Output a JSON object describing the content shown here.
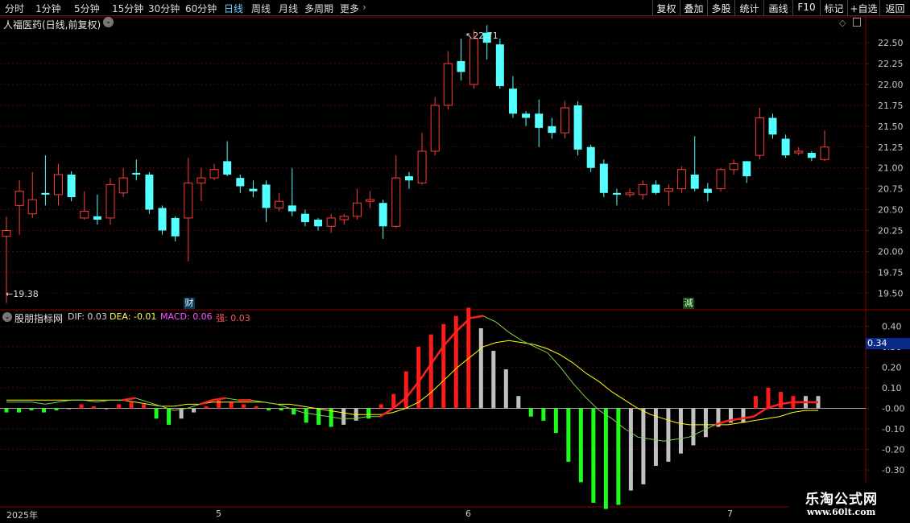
{
  "toolbar": {
    "periods": [
      "分时",
      "1分钟",
      "5分钟",
      "15分钟",
      "30分钟",
      "60分钟",
      "日线",
      "周线",
      "月线",
      "多周期",
      "更多"
    ],
    "active_period": "日线",
    "right_buttons": [
      "复权",
      "叠加",
      "多股",
      "统计",
      "画线",
      "F10",
      "标记",
      "+自选",
      "返回"
    ]
  },
  "main_panel": {
    "title": "人福医药(日线,前复权)",
    "high_label": "22.71",
    "low_label": "19.38",
    "markers": [
      "财",
      "減"
    ],
    "y_ticks": [
      "22.50",
      "22.25",
      "22.00",
      "21.75",
      "21.50",
      "21.25",
      "21.00",
      "20.75",
      "20.50",
      "20.25",
      "20.00",
      "19.75",
      "19.50"
    ]
  },
  "indicator_panel": {
    "name": "股朋指标网",
    "dif_label": "DIF:",
    "dif_value": "0.03",
    "dea_label": "DEA:",
    "dea_value": "-0.01",
    "macd_label": "MACD:",
    "macd_value": "0.06",
    "qiang_label": "强:",
    "qiang_value": "0.03",
    "current_value": "0.34",
    "y_ticks": [
      "0.40",
      "0.30",
      "0.20",
      "0.10",
      "-0.00",
      "-0.10",
      "-0.20",
      "-0.30"
    ]
  },
  "date_axis": {
    "labels": [
      "2025年",
      "5",
      "6",
      "7"
    ]
  },
  "watermark": {
    "line1": "乐淘公式网",
    "line2": "www.60lt.com"
  },
  "colors": {
    "up": "#ff3b3b",
    "down": "#54ffff",
    "grid": "#8b0000",
    "axis_text": "#c8c8c8",
    "dif": "#ffffff",
    "dea": "#ffff00",
    "macd_pos": "#ff1a1a",
    "macd_neg": "#1aff1a",
    "macd_gray": "#c0c0c0"
  },
  "chart_data": {
    "type": "candlestick",
    "price_range": [
      19.3,
      22.8
    ],
    "candles": [
      [
        20.18,
        20.25,
        20.42,
        19.38
      ],
      [
        20.55,
        20.72,
        20.85,
        20.2
      ],
      [
        20.45,
        20.62,
        20.95,
        20.4
      ],
      [
        20.7,
        20.68,
        21.15,
        20.55
      ],
      [
        20.68,
        20.92,
        21.05,
        20.55
      ],
      [
        20.92,
        20.65,
        20.96,
        20.6
      ],
      [
        20.4,
        20.48,
        20.72,
        20.38
      ],
      [
        20.42,
        20.38,
        20.68,
        20.32
      ],
      [
        20.4,
        20.8,
        20.88,
        20.32
      ],
      [
        20.7,
        20.88,
        21.0,
        20.65
      ],
      [
        20.94,
        20.92,
        21.1,
        20.85
      ],
      [
        20.92,
        20.5,
        20.95,
        20.45
      ],
      [
        20.52,
        20.25,
        20.55,
        20.2
      ],
      [
        20.4,
        20.18,
        20.42,
        20.12
      ],
      [
        20.4,
        20.82,
        21.12,
        19.88
      ],
      [
        20.82,
        20.88,
        21.0,
        20.6
      ],
      [
        20.88,
        20.98,
        21.05,
        20.85
      ],
      [
        21.08,
        20.92,
        21.32,
        20.9
      ],
      [
        20.88,
        20.78,
        20.92,
        20.7
      ],
      [
        20.75,
        20.72,
        20.85,
        20.65
      ],
      [
        20.8,
        20.52,
        20.85,
        20.35
      ],
      [
        20.52,
        20.6,
        20.7,
        20.48
      ],
      [
        20.55,
        20.48,
        21.0,
        20.42
      ],
      [
        20.45,
        20.35,
        20.5,
        20.3
      ],
      [
        20.38,
        20.3,
        20.4,
        20.25
      ],
      [
        20.3,
        20.4,
        20.45,
        20.22
      ],
      [
        20.38,
        20.42,
        20.45,
        20.32
      ],
      [
        20.42,
        20.58,
        20.75,
        20.38
      ],
      [
        20.6,
        20.62,
        20.72,
        20.52
      ],
      [
        20.58,
        20.3,
        20.62,
        20.15
      ],
      [
        20.3,
        20.88,
        21.15,
        20.28
      ],
      [
        20.9,
        20.85,
        20.95,
        20.75
      ],
      [
        20.82,
        21.2,
        21.42,
        20.8
      ],
      [
        21.2,
        21.75,
        21.85,
        21.15
      ],
      [
        21.75,
        22.25,
        22.4,
        21.7
      ],
      [
        22.28,
        22.15,
        22.55,
        22.05
      ],
      [
        22.0,
        22.55,
        22.65,
        21.95
      ],
      [
        22.62,
        22.5,
        22.71,
        22.3
      ],
      [
        22.48,
        21.98,
        22.55,
        21.95
      ],
      [
        21.95,
        21.65,
        22.1,
        21.6
      ],
      [
        21.65,
        21.6,
        21.68,
        21.5
      ],
      [
        21.65,
        21.48,
        21.82,
        21.25
      ],
      [
        21.5,
        21.42,
        21.6,
        21.35
      ],
      [
        21.42,
        21.72,
        21.8,
        21.35
      ],
      [
        21.75,
        21.22,
        21.8,
        21.15
      ],
      [
        21.25,
        21.0,
        21.28,
        20.95
      ],
      [
        21.05,
        20.7,
        21.1,
        20.65
      ],
      [
        20.7,
        20.68,
        20.75,
        20.55
      ],
      [
        20.68,
        20.7,
        20.75,
        20.65
      ],
      [
        20.68,
        20.8,
        20.85,
        20.62
      ],
      [
        20.8,
        20.7,
        20.85,
        20.68
      ],
      [
        20.72,
        20.75,
        20.8,
        20.55
      ],
      [
        20.75,
        20.98,
        21.02,
        20.7
      ],
      [
        20.92,
        20.75,
        21.38,
        20.72
      ],
      [
        20.75,
        20.7,
        20.82,
        20.6
      ],
      [
        20.75,
        20.98,
        21.0,
        20.72
      ],
      [
        20.98,
        21.05,
        21.1,
        20.92
      ],
      [
        21.08,
        20.9,
        21.08,
        20.82
      ],
      [
        21.15,
        21.6,
        21.72,
        21.1
      ],
      [
        21.6,
        21.4,
        21.65,
        21.35
      ],
      [
        21.35,
        21.15,
        21.4,
        21.12
      ],
      [
        21.18,
        21.2,
        21.25,
        21.15
      ],
      [
        21.18,
        21.12,
        21.2,
        21.08
      ],
      [
        21.1,
        21.25,
        21.45,
        21.08
      ]
    ],
    "macd_range": [
      -0.48,
      0.48
    ],
    "macd": [
      -0.02,
      -0.02,
      -0.01,
      -0.02,
      -0.01,
      0.0,
      0.02,
      0.01,
      0.0,
      0.02,
      0.03,
      0.02,
      -0.05,
      -0.08,
      -0.05,
      -0.02,
      0.01,
      0.04,
      0.03,
      0.02,
      0.01,
      -0.01,
      -0.01,
      -0.03,
      -0.07,
      -0.08,
      -0.09,
      -0.08,
      -0.06,
      -0.05,
      0.02,
      0.07,
      0.18,
      0.3,
      0.36,
      0.41,
      0.45,
      0.49,
      0.39,
      0.28,
      0.19,
      0.06,
      -0.04,
      -0.06,
      -0.12,
      -0.26,
      -0.36,
      -0.46,
      -0.49,
      -0.47,
      -0.4,
      -0.37,
      -0.28,
      -0.26,
      -0.22,
      -0.18,
      -0.14,
      -0.09,
      -0.07,
      -0.07,
      0.06,
      0.1,
      0.08,
      0.06,
      0.06,
      0.06
    ],
    "macd_color": [
      "g",
      "g",
      "g",
      "g",
      "g",
      "g",
      "r",
      "r",
      "g",
      "r",
      "r",
      "r",
      "g",
      "g",
      "n",
      "n",
      "r",
      "r",
      "r",
      "r",
      "r",
      "g",
      "g",
      "g",
      "g",
      "g",
      "g",
      "n",
      "n",
      "g",
      "r",
      "r",
      "r",
      "r",
      "r",
      "r",
      "r",
      "r",
      "g",
      "g",
      "g",
      "g",
      "g",
      "g",
      "g",
      "g",
      "g",
      "g",
      "g",
      "g",
      "n",
      "n",
      "n",
      "n",
      "n",
      "n",
      "n",
      "n",
      "n",
      "n",
      "r",
      "r",
      "r",
      "r",
      "g",
      "g"
    ],
    "dif": [
      0.03,
      0.03,
      0.03,
      0.02,
      0.03,
      0.04,
      0.04,
      0.03,
      0.04,
      0.04,
      0.05,
      0.03,
      0.01,
      -0.01,
      0.0,
      0.02,
      0.04,
      0.05,
      0.04,
      0.04,
      0.03,
      0.02,
      0.0,
      -0.02,
      -0.03,
      -0.04,
      -0.05,
      -0.05,
      -0.04,
      -0.04,
      0.0,
      0.05,
      0.13,
      0.22,
      0.31,
      0.38,
      0.44,
      0.45,
      0.42,
      0.37,
      0.33,
      0.3,
      0.27,
      0.2,
      0.12,
      0.05,
      -0.01,
      -0.05,
      -0.1,
      -0.14,
      -0.15,
      -0.16,
      -0.15,
      -0.14,
      -0.11,
      -0.08,
      -0.06,
      -0.05,
      -0.04,
      0.0,
      0.02,
      0.03,
      0.03,
      0.03
    ],
    "dea": [
      0.04,
      0.04,
      0.04,
      0.04,
      0.04,
      0.04,
      0.04,
      0.04,
      0.04,
      0.04,
      0.03,
      0.02,
      0.01,
      0.01,
      0.02,
      0.02,
      0.03,
      0.03,
      0.03,
      0.03,
      0.03,
      0.02,
      0.02,
      0.01,
      0.0,
      -0.01,
      -0.02,
      -0.03,
      -0.03,
      -0.03,
      -0.02,
      0.0,
      0.03,
      0.08,
      0.14,
      0.2,
      0.25,
      0.3,
      0.32,
      0.33,
      0.32,
      0.31,
      0.29,
      0.26,
      0.22,
      0.17,
      0.13,
      0.08,
      0.04,
      0.0,
      -0.03,
      -0.05,
      -0.07,
      -0.08,
      -0.08,
      -0.08,
      -0.08,
      -0.07,
      -0.06,
      -0.05,
      -0.04,
      -0.02,
      -0.01,
      -0.01
    ]
  }
}
